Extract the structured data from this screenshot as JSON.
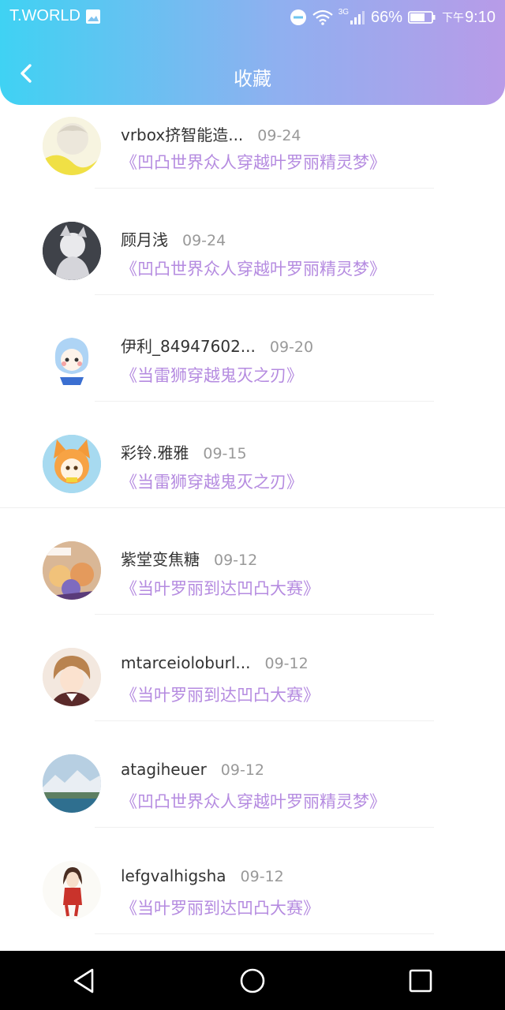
{
  "status_bar": {
    "carrier": "T.WORLD",
    "network": "3G",
    "battery": "66%",
    "time_prefix": "下午",
    "time": "9:10"
  },
  "header": {
    "title": "收藏"
  },
  "favorites": [
    {
      "user": "vrbox挤智能造...",
      "date": "09-24",
      "book": "《凹凸世界众人穿越叶罗丽精灵梦》"
    },
    {
      "user": "顾月浅",
      "date": "09-24",
      "book": "《凹凸世界众人穿越叶罗丽精灵梦》"
    },
    {
      "user": "伊利_84947602...",
      "date": "09-20",
      "book": "《当雷狮穿越鬼灭之刃》"
    },
    {
      "user": "彩铃.雅雅",
      "date": "09-15",
      "book": "《当雷狮穿越鬼灭之刃》"
    },
    {
      "user": "紫堂变焦糖",
      "date": "09-12",
      "book": "《当叶罗丽到达凹凸大赛》"
    },
    {
      "user": "mtarceioloburl...",
      "date": "09-12",
      "book": "《当叶罗丽到达凹凸大赛》"
    },
    {
      "user": "atagiheuer",
      "date": "09-12",
      "book": "《凹凸世界众人穿越叶罗丽精灵梦》"
    },
    {
      "user": "lefgvalhigsha",
      "date": "09-12",
      "book": "《当叶罗丽到达凹凸大赛》"
    }
  ],
  "colors": {
    "header_gradient": [
      "#3fd2f3",
      "#8fb0f0",
      "#b89be8"
    ],
    "book_link": "#b58be0",
    "date": "#999999"
  }
}
